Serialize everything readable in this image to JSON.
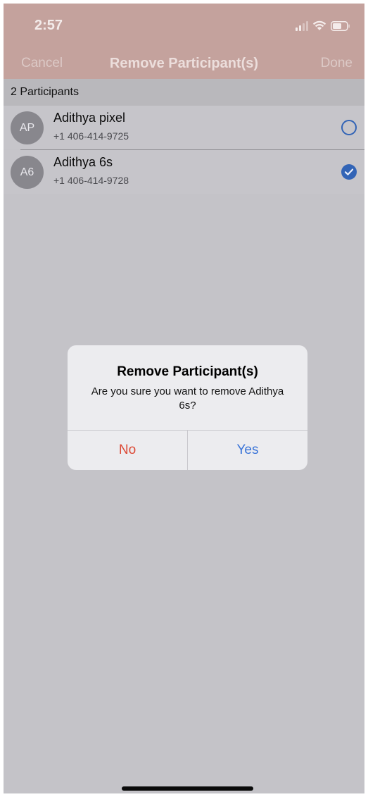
{
  "status_bar": {
    "time": "2:57"
  },
  "nav": {
    "cancel_label": "Cancel",
    "title": "Remove Participant(s)",
    "done_label": "Done"
  },
  "section": {
    "header": "2 Participants"
  },
  "participants": [
    {
      "initials": "AP",
      "name": "Adithya pixel",
      "phone": "+1 406-414-9725",
      "selected": false
    },
    {
      "initials": "A6",
      "name": "Adithya 6s",
      "phone": "+1 406-414-9728",
      "selected": true
    }
  ],
  "alert": {
    "title": "Remove Participant(s)",
    "message": "Are you sure you want to remove Adithya 6s?",
    "no_label": "No",
    "yes_label": "Yes"
  },
  "colors": {
    "header_bg": "#c4a29d",
    "accent_blue": "#3a74d8",
    "destructive_red": "#dc4a36",
    "dimmed_bg": "#c4c3c8"
  }
}
